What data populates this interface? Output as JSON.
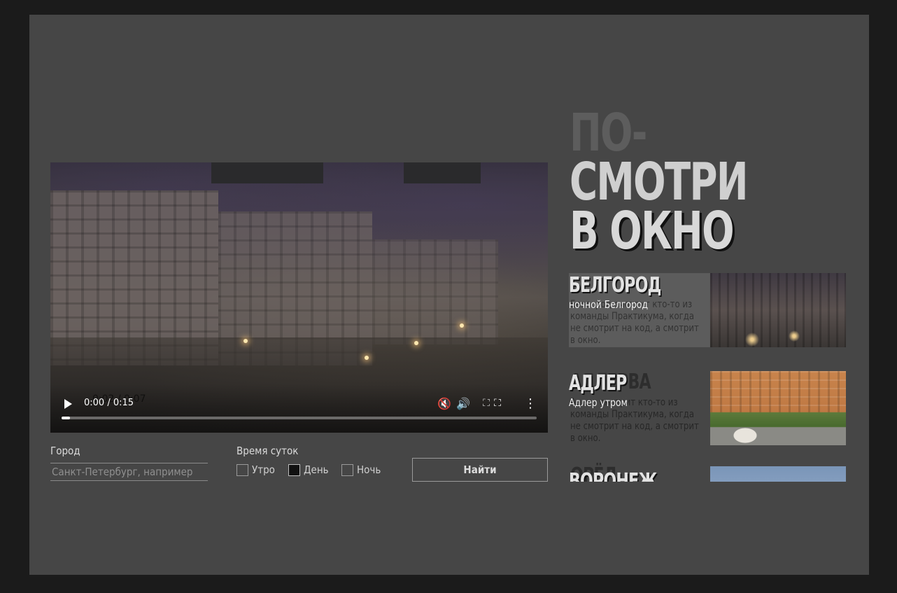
{
  "video": {
    "time": "0:00 / 0:15",
    "overlay_time": "0:02 / 0:07"
  },
  "title": {
    "line1": "ПО-",
    "line2": "СМОТРИ",
    "line3": "В ОКНО"
  },
  "filters": {
    "city_label": "Город",
    "city_placeholder": "Санкт-Петербург, например",
    "time_label": "Время суток",
    "options": [
      {
        "label": "Утро",
        "checked": false
      },
      {
        "label": "День",
        "checked": true
      },
      {
        "label": "Ночь",
        "checked": false
      }
    ],
    "search_label": "Найти"
  },
  "cities": [
    {
      "name": "БЕЛГОРОД",
      "ghost_name": "",
      "subtitle": "ночной Белгород",
      "ghost_desc": "Белгород смотрит кто-то из команды Практикума, когда не смотрит на код, а смотрит в окно.",
      "active": true
    },
    {
      "name": "АДЛЕР",
      "ghost_name": "АДЛЕРВА",
      "subtitle": "Адлер утром",
      "ghost_desc": "Адлер смотрит кто-то из команды Практикума, когда не смотрит на код, а смотрит в окно.",
      "active": false
    },
    {
      "name": "ВОРОНЕЖ",
      "ghost_name": "ОРЁЛ",
      "subtitle": "",
      "ghost_desc": "",
      "active": false
    }
  ]
}
